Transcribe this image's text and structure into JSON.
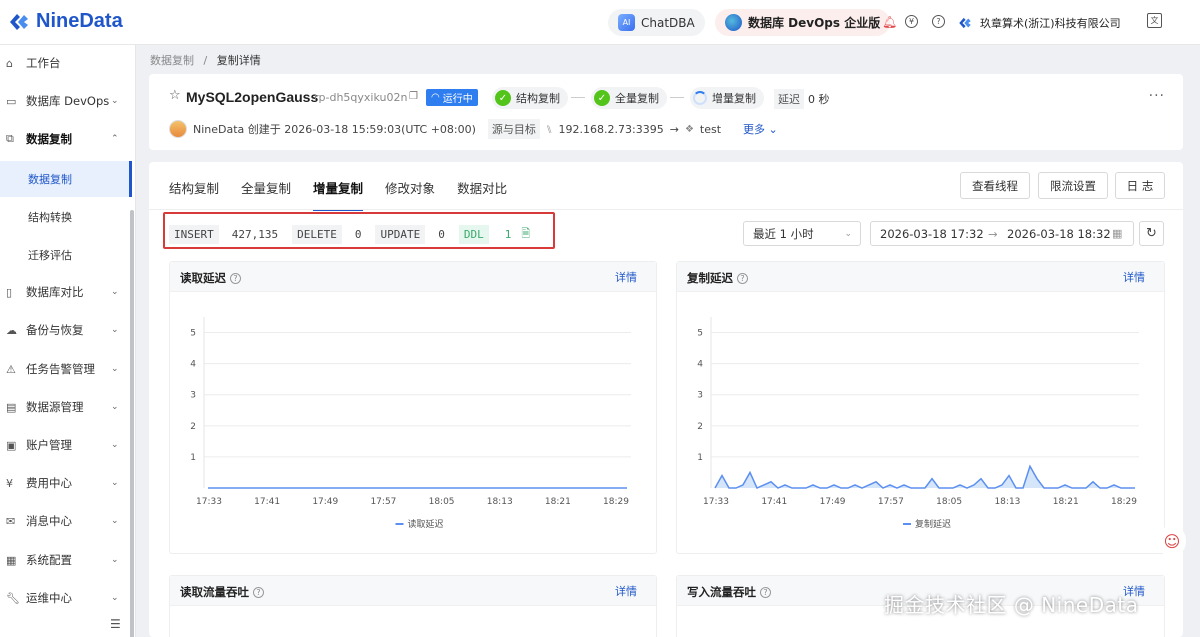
{
  "app": {
    "brand": "NineData",
    "brand_color": "#1f56c9"
  },
  "topbar": {
    "chatdba": "ChatDBA",
    "devops": "数据库 DevOps 企业版",
    "org": "玖章算术(浙江)科技有限公司"
  },
  "sidebar": {
    "items": [
      {
        "label": "工作台",
        "icon": "home-icon"
      },
      {
        "label": "数据库 DevOps",
        "icon": "devops-icon"
      },
      {
        "label": "数据复制",
        "icon": "copy-icon"
      },
      {
        "label": "数据复制"
      },
      {
        "label": "结构转换"
      },
      {
        "label": "迁移评估"
      },
      {
        "label": "数据库对比",
        "icon": "compare-icon"
      },
      {
        "label": "备份与恢复",
        "icon": "cloud-icon"
      },
      {
        "label": "任务告警管理",
        "icon": "alarm-icon"
      },
      {
        "label": "数据源管理",
        "icon": "datasource-icon"
      },
      {
        "label": "账户管理",
        "icon": "account-icon"
      },
      {
        "label": "费用中心",
        "icon": "yen-icon"
      },
      {
        "label": "消息中心",
        "icon": "mail-icon"
      },
      {
        "label": "系统配置",
        "icon": "grid-icon"
      },
      {
        "label": "运维中心",
        "icon": "wrench-icon"
      }
    ]
  },
  "breadcrumb": {
    "parent": "数据复制",
    "sep": "/",
    "current": "复制详情"
  },
  "task": {
    "name": "MySQL2openGauss",
    "id": "rp-dh5qyxiku02n",
    "status": "运行中",
    "steps": [
      "结构复制",
      "全量复制",
      "增量复制"
    ],
    "delay_label": "延迟",
    "delay_value": "0 秒",
    "creator_text": "NineData 创建于 2026-03-18 15:59:03(UTC +08:00)",
    "src_dst_label": "源与目标",
    "source": "192.168.2.73:3395",
    "arrow": "→",
    "target": "test",
    "more": "更多"
  },
  "tabs": [
    "结构复制",
    "全量复制",
    "增量复制",
    "修改对象",
    "数据对比"
  ],
  "active_tab": 2,
  "actions": {
    "threads": "查看线程",
    "throttle": "限流设置",
    "log": "日 志"
  },
  "stats": [
    {
      "label": "INSERT",
      "value": "427,135"
    },
    {
      "label": "DELETE",
      "value": "0"
    },
    {
      "label": "UPDATE",
      "value": "0"
    },
    {
      "label": "DDL",
      "value": "1"
    }
  ],
  "time_filter": {
    "preset": "最近 1 小时",
    "start": "2026-03-18 17:32",
    "sep": "→",
    "end": "2026-03-18 18:32"
  },
  "panels": {
    "read_delay": {
      "title": "读取延迟",
      "link": "详情",
      "legend": "读取延迟"
    },
    "copy_delay": {
      "title": "复制延迟",
      "link": "详情",
      "legend": "复制延迟"
    },
    "read_throughput": {
      "title": "读取流量吞吐",
      "link": "详情"
    },
    "write_throughput": {
      "title": "写入流量吞吐",
      "link": "详情"
    }
  },
  "chart_data": [
    {
      "type": "line",
      "title": "读取延迟",
      "x_ticks": [
        "17:33",
        "17:41",
        "17:49",
        "17:57",
        "18:05",
        "18:13",
        "18:21",
        "18:29"
      ],
      "y_ticks": [
        1,
        2,
        3,
        4,
        5
      ],
      "ylim": [
        0,
        5.5
      ],
      "series": [
        {
          "name": "读取延迟",
          "values": [
            0,
            0,
            0,
            0,
            0,
            0,
            0,
            0,
            0,
            0,
            0,
            0,
            0,
            0,
            0,
            0,
            0,
            0,
            0,
            0,
            0,
            0,
            0,
            0,
            0,
            0,
            0,
            0,
            0,
            0,
            0,
            0,
            0,
            0,
            0,
            0,
            0,
            0,
            0,
            0,
            0,
            0,
            0,
            0,
            0,
            0,
            0,
            0,
            0,
            0,
            0,
            0,
            0,
            0,
            0,
            0,
            0,
            0,
            0,
            0,
            0
          ]
        }
      ]
    },
    {
      "type": "area",
      "title": "复制延迟",
      "x_ticks": [
        "17:33",
        "17:41",
        "17:49",
        "17:57",
        "18:05",
        "18:13",
        "18:21",
        "18:29"
      ],
      "y_ticks": [
        1,
        2,
        3,
        4,
        5
      ],
      "ylim": [
        0,
        5.5
      ],
      "series": [
        {
          "name": "复制延迟",
          "values": [
            0,
            0.4,
            0,
            0,
            0.1,
            0.5,
            0,
            0.1,
            0.2,
            0,
            0.1,
            0,
            0,
            0,
            0.1,
            0,
            0,
            0.1,
            0,
            0,
            0.1,
            0,
            0.1,
            0.2,
            0,
            0.1,
            0,
            0.1,
            0,
            0,
            0,
            0.3,
            0,
            0,
            0,
            0.1,
            0,
            0.1,
            0.3,
            0,
            0,
            0.1,
            0.4,
            0,
            0,
            0.7,
            0.3,
            0,
            0,
            0,
            0.1,
            0,
            0,
            0,
            0.2,
            0,
            0,
            0.1,
            0,
            0,
            0
          ]
        }
      ]
    }
  ],
  "watermark": "掘金技术社区 @ NineData"
}
